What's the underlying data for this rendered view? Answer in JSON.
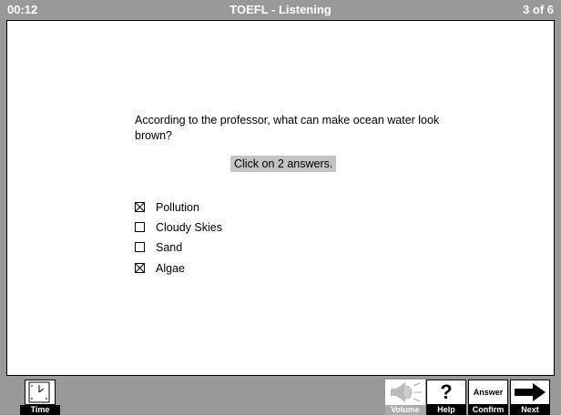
{
  "header": {
    "timer": "00:12",
    "title": "TOEFL  -  Listening",
    "progress": "3 of 6"
  },
  "question": {
    "text": "According to the professor, what can make ocean water look brown?",
    "instruction": "Click on 2 answers."
  },
  "options": [
    {
      "label": "Pollution",
      "checked": true
    },
    {
      "label": "Cloudy Skies",
      "checked": false
    },
    {
      "label": "Sand",
      "checked": false
    },
    {
      "label": "Algae",
      "checked": true
    }
  ],
  "toolbar": {
    "time_label": "Time",
    "volume_label": "Volume",
    "help_label": "Help",
    "help_symbol": "?",
    "confirm_face": "Answer",
    "confirm_label": "Confirm",
    "next_label": "Next"
  },
  "colors": {
    "chrome": "#999999",
    "panel": "#ffffff",
    "instruction_bg": "#c4c4c4",
    "caption_bg": "#000000"
  }
}
